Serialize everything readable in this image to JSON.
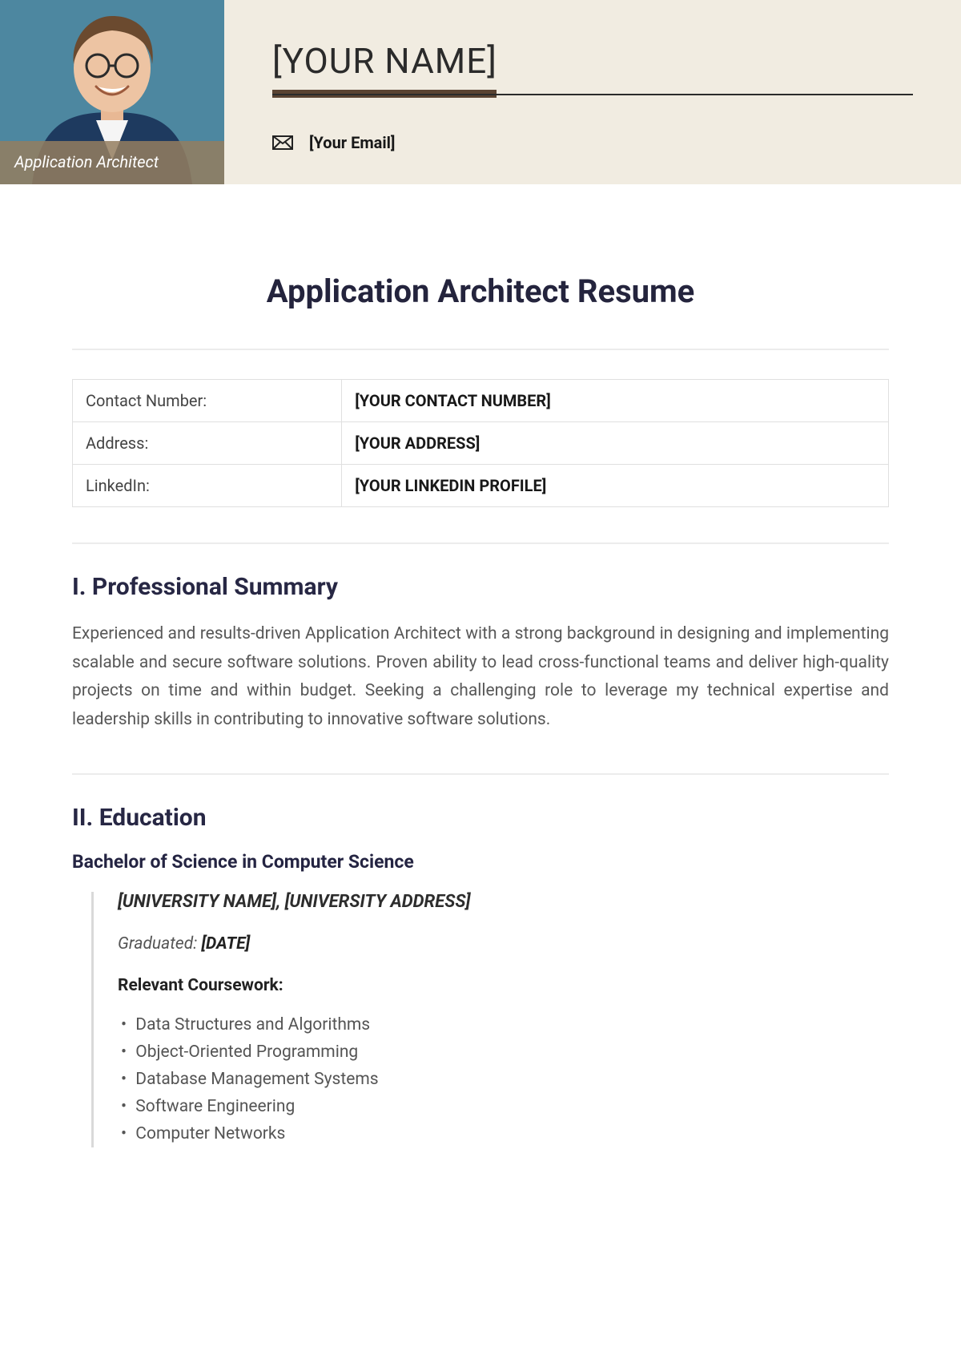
{
  "header": {
    "job_title_overlay": "Application Architect",
    "name": "[YOUR NAME]",
    "email": "[Your Email]"
  },
  "doc_title": "Application Architect Resume",
  "info_table": [
    {
      "label": "Contact Number:",
      "value": "[YOUR CONTACT NUMBER]"
    },
    {
      "label": "Address:",
      "value": "[YOUR ADDRESS]"
    },
    {
      "label": "LinkedIn:",
      "value": "[YOUR LINKEDIN PROFILE]"
    }
  ],
  "sections": {
    "summary": {
      "heading": "I. Professional Summary",
      "text": "Experienced and results-driven Application Architect with a strong background in designing and implementing scalable and secure software solutions. Proven ability to lead cross-functional teams and deliver high-quality projects on time and within budget. Seeking a challenging role to leverage my technical expertise and leadership skills in contributing to innovative software solutions."
    },
    "education": {
      "heading": "II. Education",
      "degree": "Bachelor of Science in Computer Science",
      "university_line": "[UNIVERSITY NAME], [UNIVERSITY ADDRESS]",
      "graduated_label": "Graduated: ",
      "graduated_value": "[DATE]",
      "coursework_label": "Relevant Coursework:",
      "courses": [
        "Data Structures and Algorithms",
        "Object-Oriented Programming",
        "Database Management Systems",
        "Software Engineering",
        "Computer Networks"
      ]
    }
  }
}
